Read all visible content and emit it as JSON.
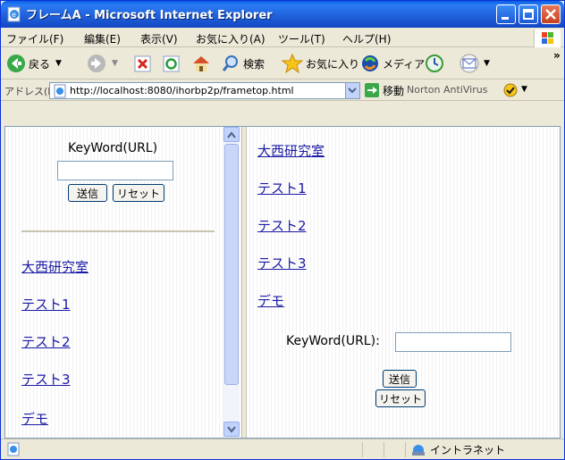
{
  "window": {
    "title": "フレームA - Microsoft Internet Explorer"
  },
  "menu": {
    "items": [
      "ファイル(F)",
      "編集(E)",
      "表示(V)",
      "お気に入り(A)",
      "ツール(T)",
      "ヘルプ(H)"
    ]
  },
  "toolbar": {
    "back": "戻る",
    "search": "検索",
    "favorites": "お気に入り",
    "media": "メディア"
  },
  "address": {
    "label": "アドレス(D)",
    "url": "http://localhost:8080/ihorbp2p/frametop.html",
    "go": "移動",
    "norton": "Norton AntiVirus"
  },
  "left_frame": {
    "keyword_label": "KeyWord(URL)",
    "keyword_value": "",
    "submit": "送信",
    "reset": "リセット",
    "links": [
      "大西研究室",
      "テスト1",
      "テスト2",
      "テスト3",
      "デモ"
    ]
  },
  "right_frame": {
    "links": [
      "大西研究室",
      "テスト1",
      "テスト2",
      "テスト3",
      "デモ"
    ],
    "keyword_label": "KeyWord(URL):",
    "keyword_value": "",
    "submit": "送信",
    "reset": "リセット"
  },
  "status": {
    "zone": "イントラネット"
  },
  "colors": {
    "titlebar": "#1f5fd8",
    "link": "#1a1aa6",
    "chrome": "#ece9d8"
  }
}
